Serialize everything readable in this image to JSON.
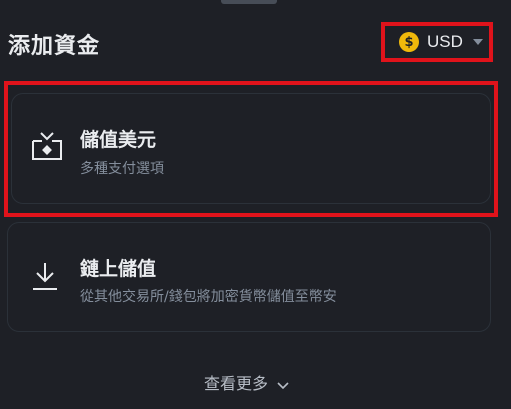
{
  "header": {
    "title": "添加資金",
    "currency": {
      "code": "USD",
      "symbol": "$",
      "icon": "dollar-coin-icon",
      "accent": "#f0b90b"
    }
  },
  "options": [
    {
      "title": "儲值美元",
      "subtitle": "多種支付選項",
      "icon": "deposit-card-icon"
    },
    {
      "title": "鏈上儲值",
      "subtitle": "從其他交易所/錢包將加密貨幣儲值至幣安",
      "icon": "download-arrow-icon"
    }
  ],
  "footer": {
    "see_more": "查看更多",
    "icon": "chevron-down-icon"
  },
  "colors": {
    "background": "#1e2026",
    "highlight": "#e0131b",
    "text_primary": "#eaecef",
    "text_secondary": "#848e9c"
  }
}
